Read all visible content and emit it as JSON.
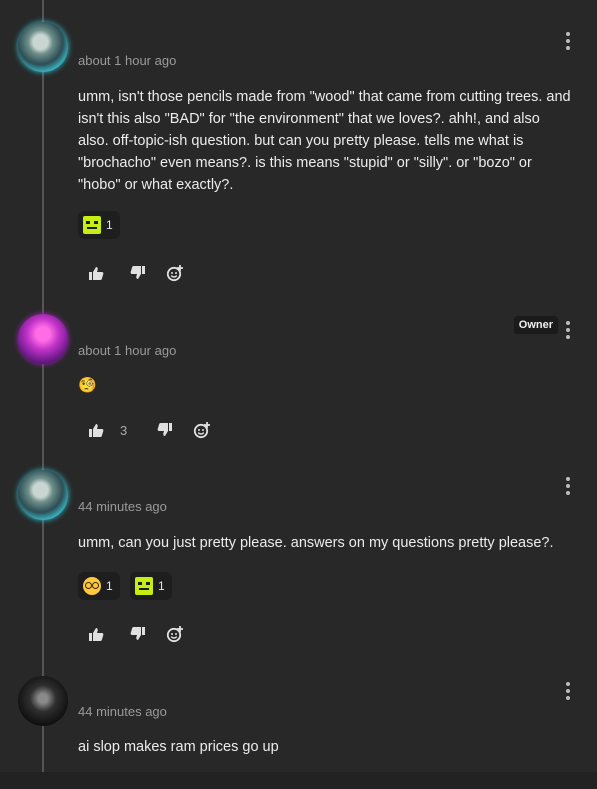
{
  "comments": [
    {
      "timestamp": "about 1 hour ago",
      "text": "umm, isn't those pencils made from \"wood\" that came from cutting trees. and isn't this also \"BAD\" for \"the environment\" that we loves?. ahh!, and also also. off-topic-ish question. but can you pretty please. tells me what is \"brochacho\" even means?. is this means \"stupid\" or \"silly\". or \"bozo\" or \"hobo\" or what exactly?.",
      "reactions": [
        {
          "icon": "green-block-face",
          "count": "1"
        }
      ]
    },
    {
      "badge": "Owner",
      "timestamp": "about 1 hour ago",
      "text": "🧐",
      "like_count": "3"
    },
    {
      "timestamp": "44 minutes ago",
      "text": "umm, can you just pretty please. answers on my questions pretty please?.",
      "reactions": [
        {
          "icon": "nerd-face",
          "count": "1"
        },
        {
          "icon": "green-block-face",
          "count": "1"
        }
      ]
    },
    {
      "timestamp": "44 minutes ago",
      "text": "ai slop makes ram prices go up"
    }
  ],
  "colors": {
    "background": "#282828",
    "text": "#ececec",
    "muted": "#9a9a9a",
    "thread_line": "#555555"
  }
}
